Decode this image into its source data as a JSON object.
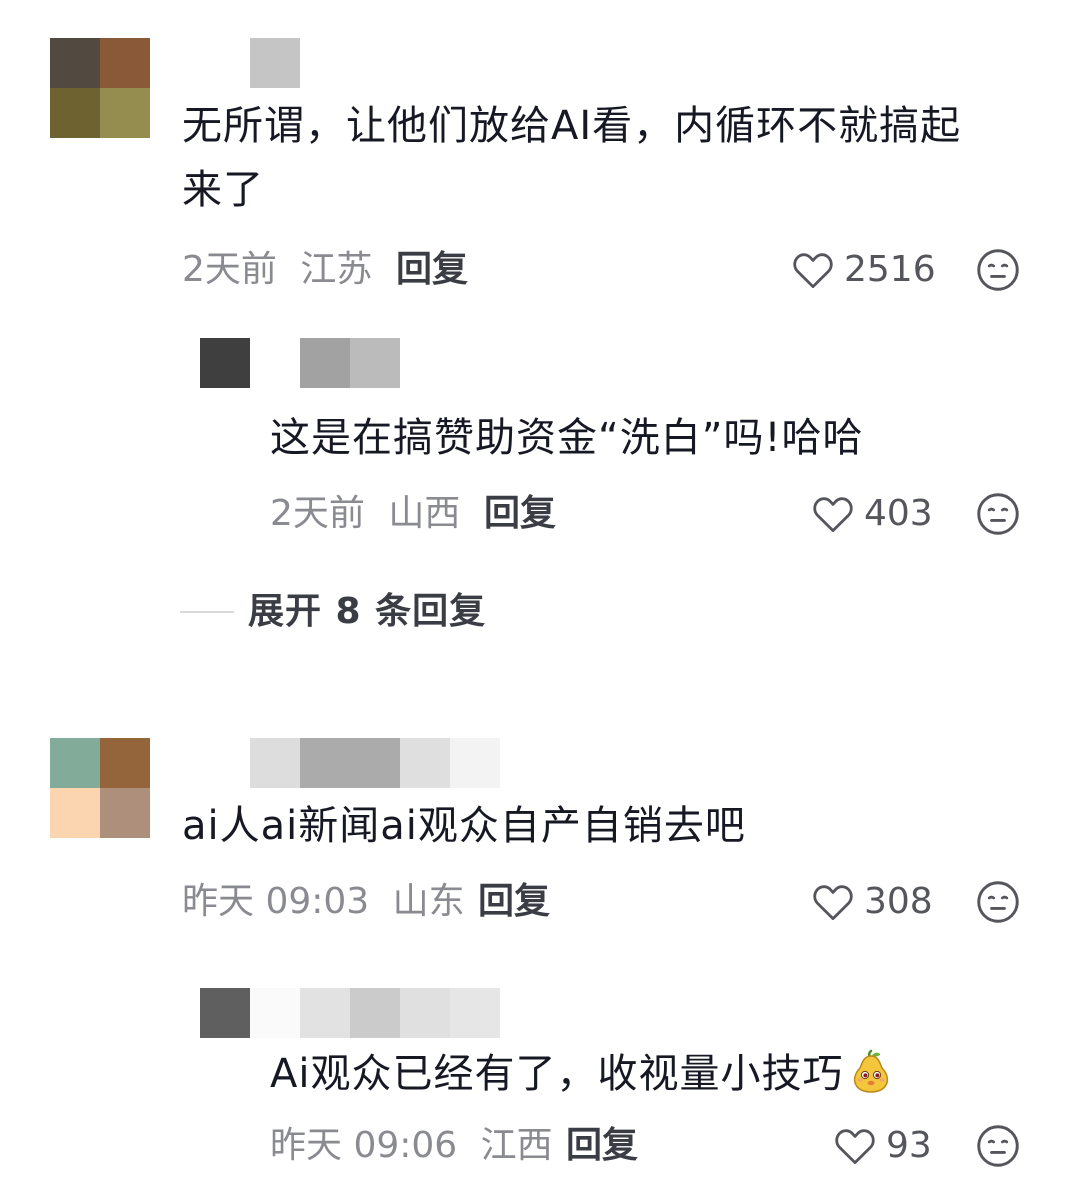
{
  "comments": [
    {
      "text_line1": "无所谓，让他们放给AI看，内循环不就搞起",
      "text_line2": "来了",
      "time": "2天前",
      "location": "江苏",
      "reply_label": "回复",
      "likes": "2516",
      "avatar_colors": [
        "#524a40",
        "#8a5a38",
        "#6e6231",
        "#958c50"
      ],
      "name_colors": [
        "#c5c5c5"
      ],
      "replies": [
        {
          "text": "这是在搞赞助资金“洗白”吗!哈哈",
          "time": "2天前",
          "location": "山西",
          "reply_label": "回复",
          "likes": "403",
          "avatar_colors": [
            "#3f3f3f"
          ],
          "name_colors": [
            "#a2a2a2",
            "#bbbbbb"
          ]
        }
      ],
      "expand_label": "展开 8 条回复"
    },
    {
      "text_line1": "ai人ai新闻ai观众自产自销去吧",
      "time": "昨天 09:03",
      "location": "山东",
      "reply_label": "回复",
      "likes": "308",
      "avatar_colors": [
        "#83ab9a",
        "#94643a",
        "#fbd5b0",
        "#ad8f7b"
      ],
      "name_colors": [
        "#dddddd",
        "#ababab",
        "#ababab",
        "#dfdfdf",
        "#f3f3f3"
      ],
      "replies": [
        {
          "text": "Ai观众已经有了，收视量小技巧",
          "time": "昨天 09:06",
          "location": "江西",
          "reply_label": "回复",
          "likes": "93",
          "avatar_colors": [
            "#5f5f5f"
          ],
          "name_colors": [
            "#fafafa",
            "#e2e2e2",
            "#cbcbcb",
            "#e0e0e0",
            "#e6e6e6"
          ]
        }
      ]
    }
  ],
  "icons": {
    "like": "heart-outline-icon",
    "dislike": "neutral-face-icon",
    "emoji": "pear-emoji-icon"
  }
}
